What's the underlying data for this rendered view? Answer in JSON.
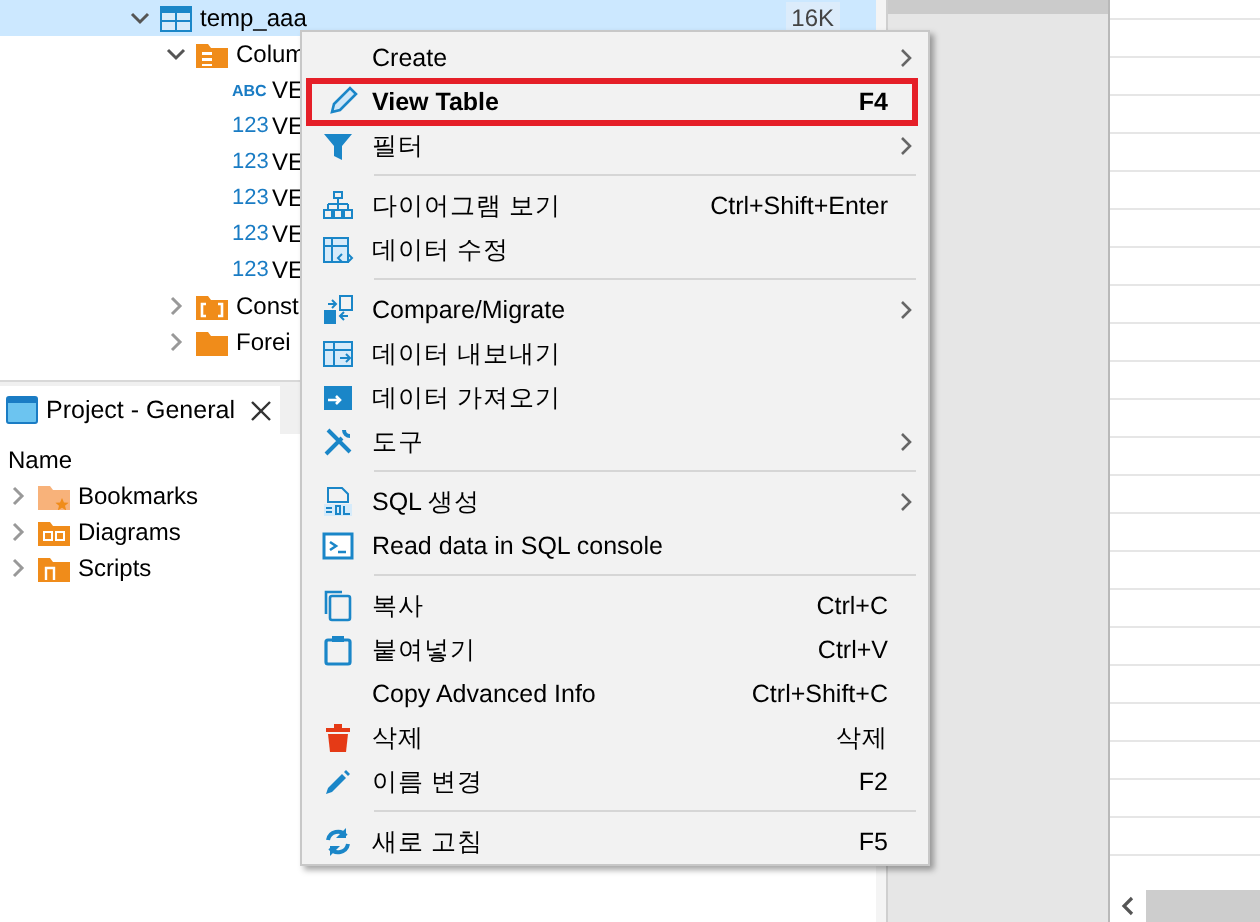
{
  "tree": {
    "items": [
      {
        "label": "temp_aaa",
        "kind": "table",
        "expanded": true,
        "selected": true,
        "size": "16K",
        "children": [
          {
            "label": "Colum",
            "kind": "columns-folder",
            "expanded": true,
            "selected": false,
            "children": [
              {
                "label": "VE",
                "kind": "column",
                "type_label": "ABC",
                "selected": false
              },
              {
                "label": "VE",
                "kind": "column",
                "type_label": "123",
                "selected": false
              },
              {
                "label": "VE",
                "kind": "column",
                "type_label": "123",
                "selected": false
              },
              {
                "label": "VE",
                "kind": "column",
                "type_label": "123",
                "selected": false
              },
              {
                "label": "VE",
                "kind": "column",
                "type_label": "123",
                "selected": false
              },
              {
                "label": "VE",
                "kind": "column",
                "type_label": "123",
                "selected": false
              }
            ]
          },
          {
            "label": "Const",
            "kind": "constraints-folder",
            "expanded": false,
            "selected": false
          },
          {
            "label": "Forei",
            "kind": "folder",
            "expanded": false,
            "selected": false
          }
        ]
      }
    ]
  },
  "project_panel": {
    "tab": {
      "title": "Project - General",
      "selected": true
    },
    "column_header": "Name",
    "items": [
      {
        "label": "Bookmarks",
        "kind": "bookmarks-folder",
        "expanded": false
      },
      {
        "label": "Diagrams",
        "kind": "diagrams-folder",
        "expanded": false
      },
      {
        "label": "Scripts",
        "kind": "scripts-folder",
        "expanded": false
      }
    ]
  },
  "context_menu": {
    "items": [
      {
        "kind": "item",
        "label": "Create",
        "submenu": true,
        "bold": false,
        "highlighted": false
      },
      {
        "kind": "item",
        "label": "View Table",
        "shortcut": "F4",
        "submenu": false,
        "bold": true,
        "highlighted": true
      },
      {
        "kind": "item",
        "label": "필터",
        "submenu": true,
        "bold": false,
        "highlighted": false
      },
      {
        "kind": "separator"
      },
      {
        "kind": "item",
        "label": "다이어그램 보기",
        "shortcut": "Ctrl+Shift+Enter",
        "submenu": false,
        "bold": false,
        "highlighted": false
      },
      {
        "kind": "item",
        "label": "데이터 수정",
        "submenu": false,
        "bold": false,
        "highlighted": false
      },
      {
        "kind": "separator"
      },
      {
        "kind": "item",
        "label": "Compare/Migrate",
        "submenu": true,
        "bold": false,
        "highlighted": false
      },
      {
        "kind": "item",
        "label": "데이터 내보내기",
        "submenu": false,
        "bold": false,
        "highlighted": false
      },
      {
        "kind": "item",
        "label": "데이터 가져오기",
        "submenu": false,
        "bold": false,
        "highlighted": false
      },
      {
        "kind": "item",
        "label": "도구",
        "submenu": true,
        "bold": false,
        "highlighted": false
      },
      {
        "kind": "separator"
      },
      {
        "kind": "item",
        "label": "SQL 생성",
        "submenu": true,
        "bold": false,
        "highlighted": false
      },
      {
        "kind": "item",
        "label": "Read data in SQL console",
        "submenu": false,
        "bold": false,
        "highlighted": false
      },
      {
        "kind": "separator"
      },
      {
        "kind": "item",
        "label": "복사",
        "shortcut": "Ctrl+C",
        "submenu": false,
        "bold": false,
        "highlighted": false
      },
      {
        "kind": "item",
        "label": "붙여넣기",
        "shortcut": "Ctrl+V",
        "submenu": false,
        "bold": false,
        "highlighted": false
      },
      {
        "kind": "item",
        "label": "Copy Advanced Info",
        "shortcut": "Ctrl+Shift+C",
        "submenu": false,
        "bold": false,
        "highlighted": false
      },
      {
        "kind": "item",
        "label": "삭제",
        "shortcut": "삭제",
        "submenu": false,
        "bold": false,
        "highlighted": false
      },
      {
        "kind": "item",
        "label": "이름 변경",
        "shortcut": "F2",
        "submenu": false,
        "bold": false,
        "highlighted": false
      },
      {
        "kind": "separator"
      },
      {
        "kind": "item",
        "label": "새로 고침",
        "shortcut": "F5",
        "submenu": false,
        "bold": false,
        "highlighted": false
      }
    ]
  }
}
